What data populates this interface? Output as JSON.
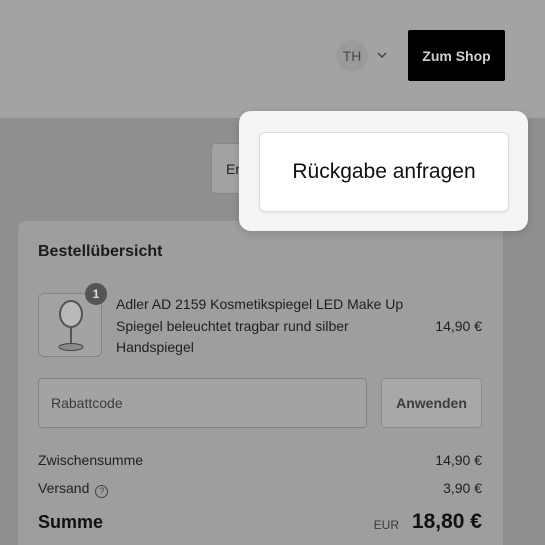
{
  "header": {
    "avatar_initials": "TH",
    "shop_button": "Zum Shop"
  },
  "action": {
    "partial_button_label": "Er",
    "return_button": "Rückgabe anfragen"
  },
  "summary": {
    "title": "Bestellübersicht",
    "item": {
      "quantity": "1",
      "name": "Adler AD 2159 Kosmetikspiegel LED Make Up Spiegel beleuchtet tragbar rund silber Handspiegel",
      "price": "14,90 €"
    },
    "coupon": {
      "placeholder": "Rabattcode",
      "apply_button": "Anwenden"
    },
    "subtotal_label": "Zwischensumme",
    "subtotal_value": "14,90 €",
    "shipping_label": "Versand",
    "shipping_value": "3,90 €",
    "total_label": "Summe",
    "currency": "EUR",
    "total_value": "18,80 €"
  }
}
